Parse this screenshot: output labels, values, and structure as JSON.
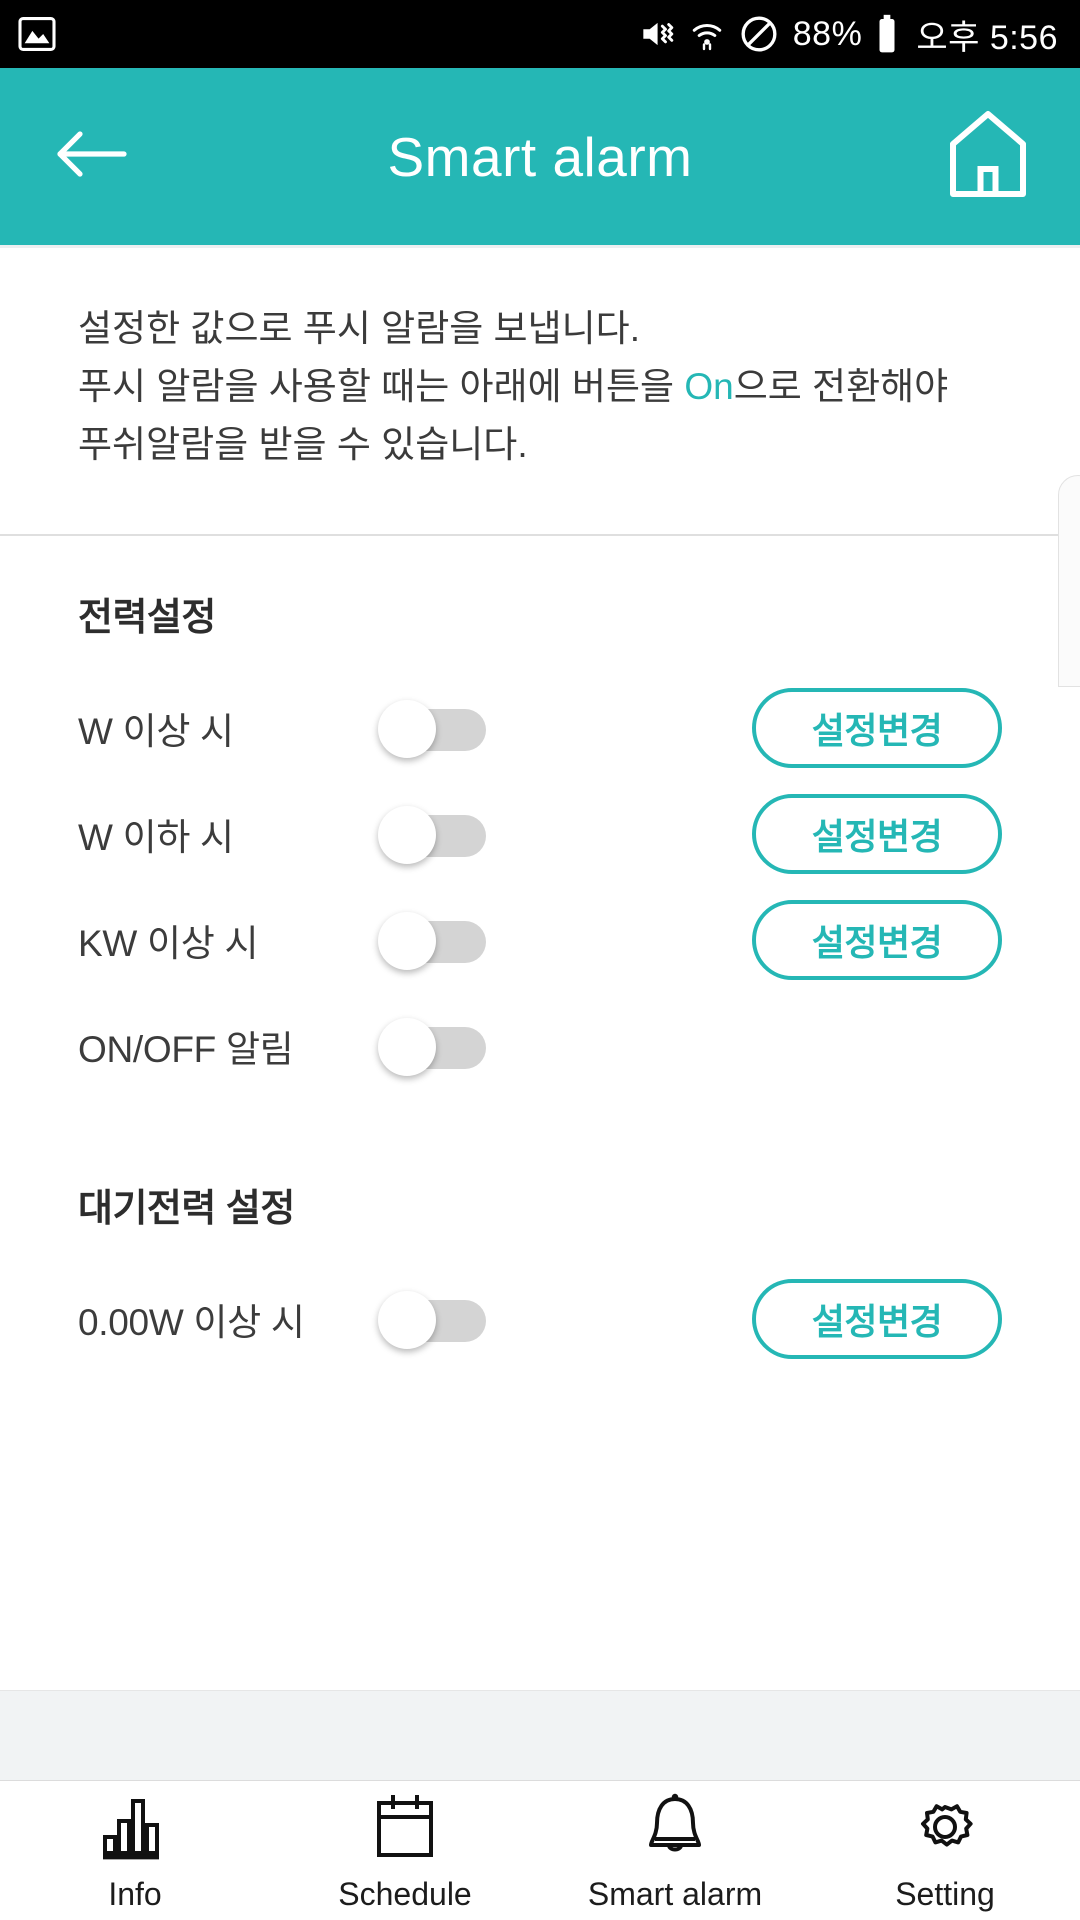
{
  "statusbar": {
    "left_icon": "image-icon",
    "icons": [
      "vibrate-mute-icon",
      "wifi-icon",
      "do-not-disturb-icon"
    ],
    "battery_percent": "88%",
    "battery_icon": "battery-icon",
    "clock": "오후 5:56"
  },
  "appbar": {
    "back_icon": "back-arrow-icon",
    "title": "Smart alarm",
    "home_icon": "home-icon",
    "background_color": "#25b7b5"
  },
  "description": {
    "line1": "설정한 값으로 푸시 알람을 보냅니다.",
    "line2_before": "푸시 알람을 사용할 때는 아래에 버튼을 ",
    "line2_highlight": "On",
    "line2_after": "으로 전환해야",
    "line3": "푸쉬알람을 받을 수 있습니다.",
    "highlight_color": "#25b7b5"
  },
  "sections": [
    {
      "title": "전력설정",
      "rows": [
        {
          "label": "W 이상 시",
          "toggle": "off",
          "button": "설정변경",
          "has_button": true
        },
        {
          "label": "W 이하 시",
          "toggle": "off",
          "button": "설정변경",
          "has_button": true
        },
        {
          "label": "KW 이상 시",
          "toggle": "off",
          "button": "설정변경",
          "has_button": true
        },
        {
          "label": "ON/OFF 알림",
          "toggle": "off",
          "button": "",
          "has_button": false
        }
      ]
    },
    {
      "title": "대기전력 설정",
      "rows": [
        {
          "label": "0.00W 이상 시",
          "toggle": "off",
          "button": "설정변경",
          "has_button": true
        }
      ]
    }
  ],
  "bottom_nav": {
    "items": [
      {
        "label": "Info",
        "icon": "bar-chart-icon"
      },
      {
        "label": "Schedule",
        "icon": "calendar-icon"
      },
      {
        "label": "Smart alarm",
        "icon": "bell-icon"
      },
      {
        "label": "Setting",
        "icon": "gear-icon"
      }
    ],
    "active": "Smart alarm"
  }
}
